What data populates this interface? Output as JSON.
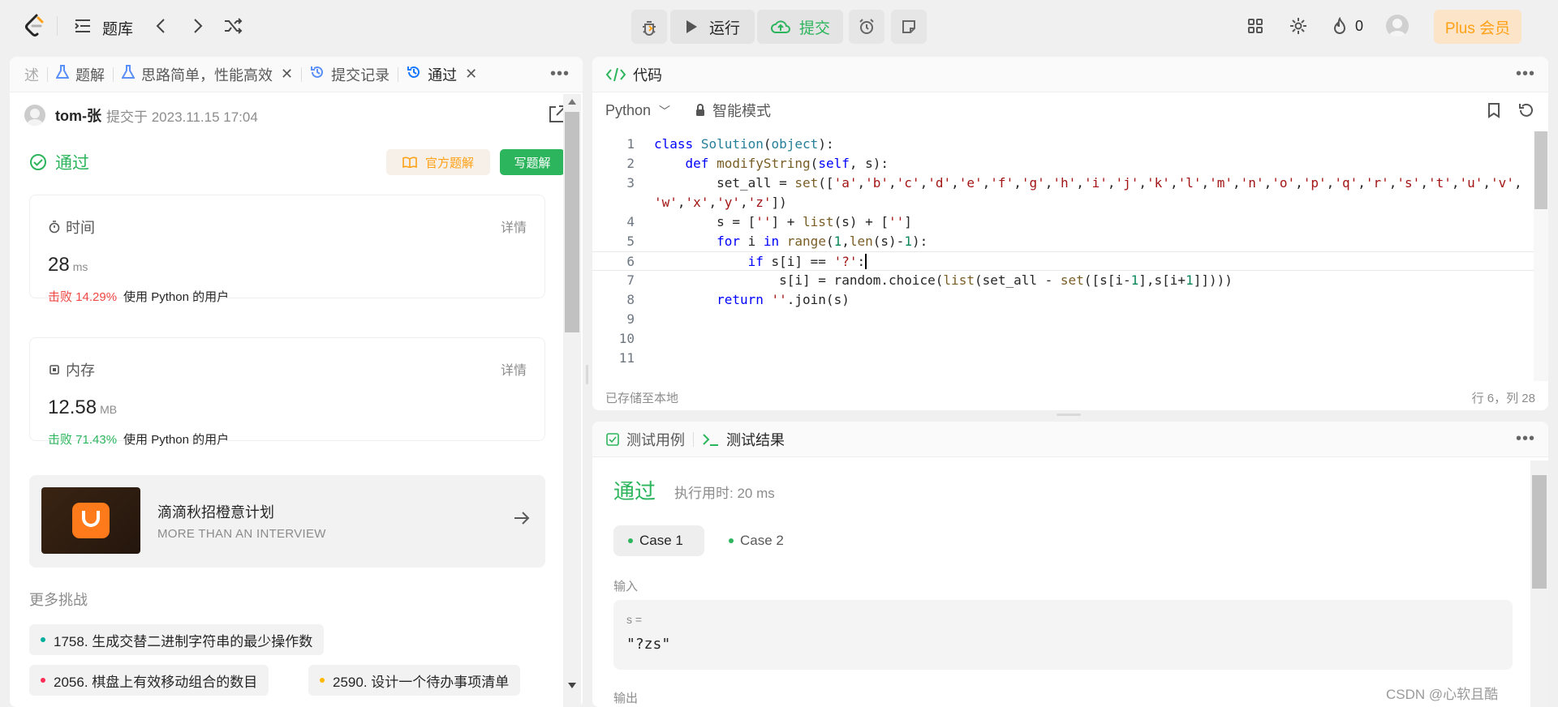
{
  "topbar": {
    "problem_bank": "题库",
    "run": "运行",
    "submit": "提交",
    "streak_count": "0",
    "plus": "Plus 会员"
  },
  "left": {
    "tabs": [
      {
        "label": "述"
      },
      {
        "label": "题解"
      },
      {
        "label": "思路简单，性能高效"
      },
      {
        "label": "提交记录"
      },
      {
        "label": "通过"
      }
    ],
    "submitter": "tom-张",
    "submitted_at": "提交于 2023.11.15 17:04",
    "status": "通过",
    "official_solution": "官方题解",
    "write_solution": "写题解",
    "time": {
      "title": "时间",
      "detail": "详情",
      "value": "28",
      "unit": "ms",
      "beat": "击败 14.29%",
      "beat_suffix": "使用 Python 的用户"
    },
    "memory": {
      "title": "内存",
      "detail": "详情",
      "value": "12.58",
      "unit": "MB",
      "beat": "击败 71.43%",
      "beat_suffix": "使用 Python 的用户"
    },
    "ad": {
      "title": "滴滴秋招橙意计划",
      "subtitle": "MORE THAN AN INTERVIEW"
    },
    "more_title": "更多挑战",
    "challenges": [
      {
        "label": "1758. 生成交替二进制字符串的最少操作数",
        "color": "#00af9b"
      },
      {
        "label": "2056. 棋盘上有效移动组合的数目",
        "color": "#ff2d55"
      },
      {
        "label": "2590. 设计一个待办事项清单",
        "color": "#ffb800"
      }
    ]
  },
  "code": {
    "title": "代码",
    "language": "Python",
    "mode": "智能模式",
    "saved": "已存储至本地",
    "cursor": "行 6，列 28",
    "line_numbers": [
      "1",
      "2",
      "3",
      "",
      "4",
      "5",
      "6",
      "7",
      "8",
      "9",
      "10",
      "11"
    ]
  },
  "result": {
    "tab_cases": "测试用例",
    "tab_results": "测试结果",
    "status": "通过",
    "exec_time": "执行用时: 20 ms",
    "case1": "Case 1",
    "case2": "Case 2",
    "input_label": "输入",
    "input_var": "s =",
    "input_value": "\"?zs\"",
    "output_label": "输出"
  },
  "watermark": "CSDN @心软且酷",
  "colors": {
    "accent_green": "#2db55d",
    "accent_orange": "#ffa116",
    "fail_red": "#ef4743"
  }
}
